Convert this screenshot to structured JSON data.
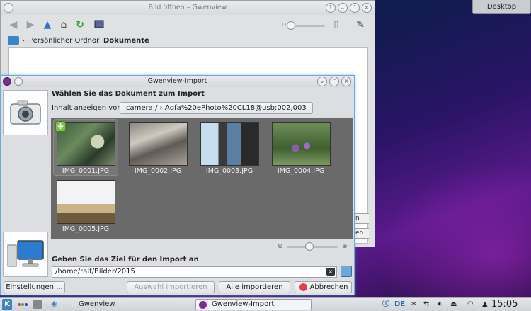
{
  "desktop": {
    "button_label": "Desktop"
  },
  "main_window": {
    "title": "Bild öffnen – Gwenview",
    "breadcrumb": [
      "Persönlicher Ordner",
      "Dokumente"
    ],
    "side_buttons": [
      "n",
      "en"
    ]
  },
  "import_dialog": {
    "title": "Gwenview-Import",
    "heading": "Wählen Sie das Dokument zum Import",
    "source_label": "Inhalt anzeigen von:",
    "source_value": "camera:/ › Agfa%20ePhoto%20CL18@usb:002,003",
    "thumbnails": [
      {
        "name": "IMG_0001.JPG",
        "selected": true
      },
      {
        "name": "IMG_0002.JPG",
        "selected": false
      },
      {
        "name": "IMG_0003.JPG",
        "selected": false
      },
      {
        "name": "IMG_0004.JPG",
        "selected": false
      },
      {
        "name": "IMG_0005.JPG",
        "selected": false
      }
    ],
    "dest_label": "Geben Sie das Ziel für den Import an",
    "dest_value": "/home/ralf/Bilder/2015",
    "buttons": {
      "settings": "Einstellungen ...",
      "import_selection": "Auswahl importieren",
      "import_all": "Alle importieren",
      "cancel": "Abbrechen"
    }
  },
  "taskbar": {
    "tasks": [
      "Gwenview",
      "Gwenview-Import"
    ],
    "layout": "DE",
    "clock": "15:05"
  },
  "colors": {
    "accent": "#3daee9",
    "cancel_red": "#da4453",
    "selection_plus": "#7dc24a"
  }
}
